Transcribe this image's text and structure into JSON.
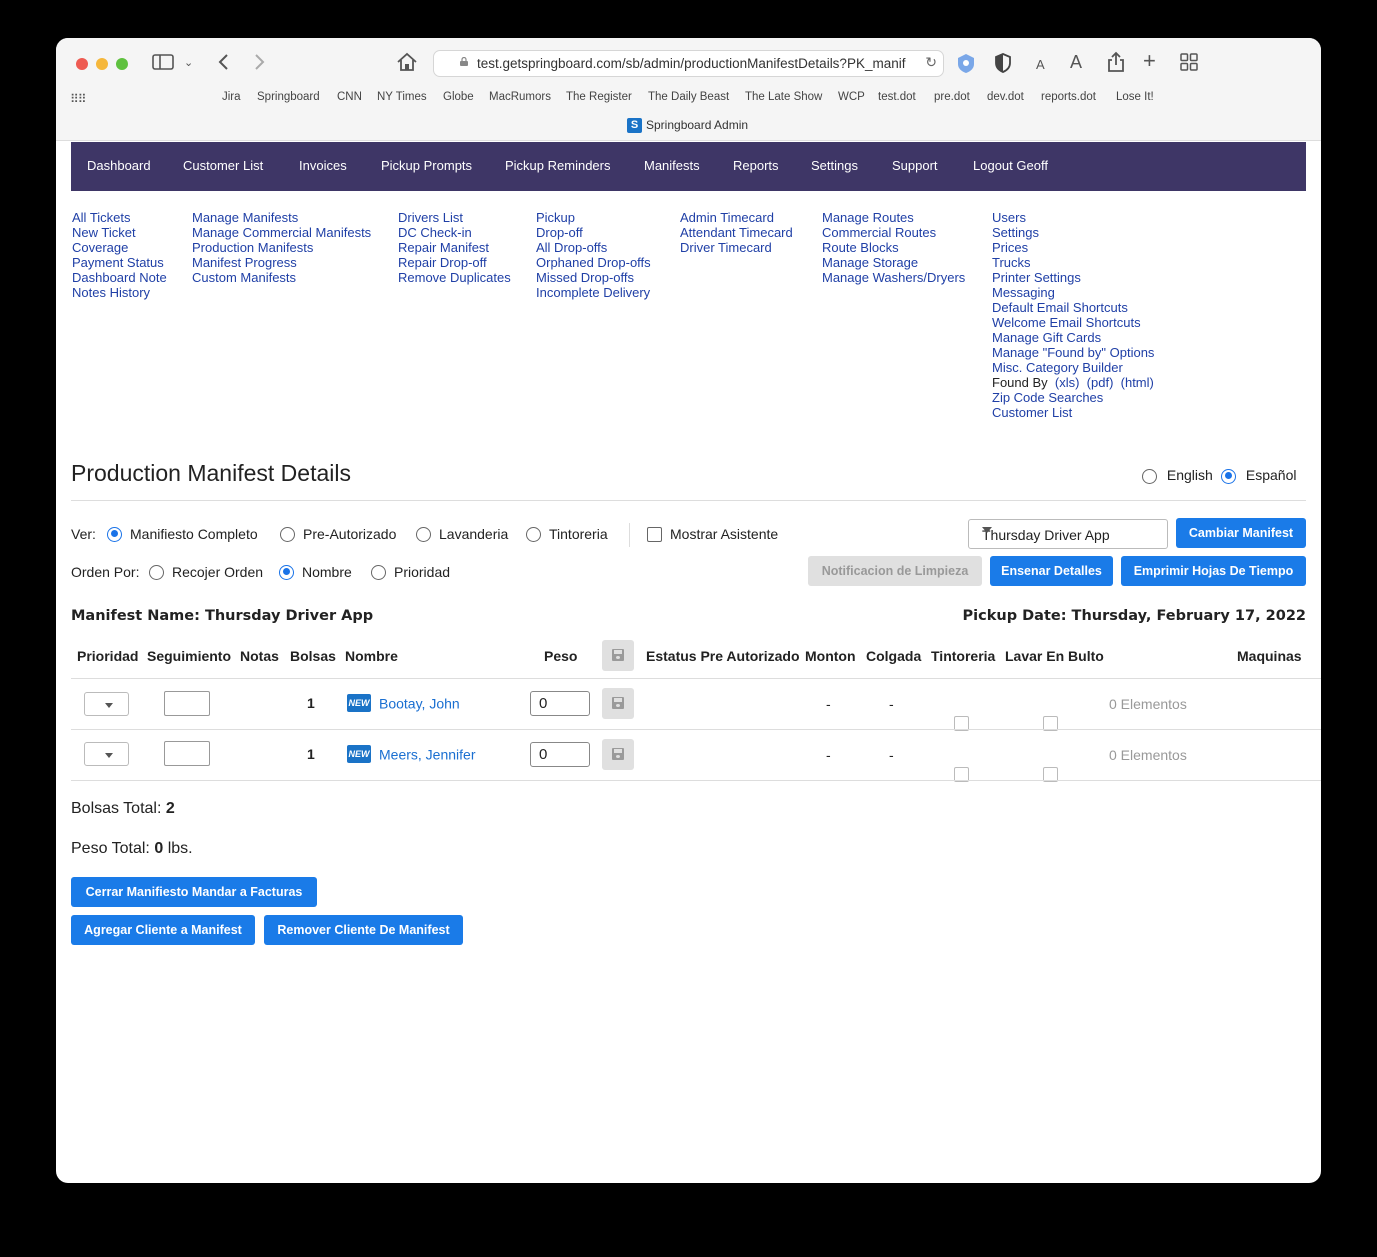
{
  "browser": {
    "url": "test.getspringboard.com/sb/admin/productionManifestDetails?PK_manif",
    "tab_title": "Springboard Admin",
    "favicon_letter": "S",
    "bookmarks": [
      "Jira",
      "Springboard",
      "CNN",
      "NY Times",
      "Globe",
      "MacRumors",
      "The Register",
      "The Daily Beast",
      "The Late Show",
      "WCP",
      "test.dot",
      "pre.dot",
      "dev.dot",
      "reports.dot",
      "Lose It!"
    ],
    "text_size_small": "A",
    "text_size_large": "A"
  },
  "nav": [
    "Dashboard",
    "Customer List",
    "Invoices",
    "Pickup Prompts",
    "Pickup Reminders",
    "Manifests",
    "Reports",
    "Settings",
    "Support",
    "Logout Geoff"
  ],
  "submenu": {
    "col1": [
      "All Tickets",
      "New Ticket",
      "Coverage",
      "Payment Status",
      "Dashboard Note",
      "Notes History"
    ],
    "col2": [
      "Manage Manifests",
      "Manage Commercial Manifests",
      "Production Manifests",
      "Manifest Progress",
      "Custom Manifests"
    ],
    "col3": [
      "Drivers List",
      "DC Check-in",
      "Repair Manifest",
      "Repair Drop-off",
      "Remove Duplicates"
    ],
    "col4": [
      "Pickup",
      "Drop-off",
      "All Drop-offs",
      "Orphaned Drop-offs",
      "Missed Drop-offs",
      "Incomplete Delivery"
    ],
    "col5": [
      "Admin Timecard",
      "Attendant Timecard",
      "Driver Timecard"
    ],
    "col6": [
      "Manage Routes",
      "Commercial Routes",
      "Route Blocks",
      "Manage Storage",
      "Manage Washers/Dryers"
    ],
    "col7": [
      "Users",
      "Settings",
      "Prices",
      "Trucks",
      "Printer Settings",
      "Messaging",
      "Default Email Shortcuts",
      "Welcome Email Shortcuts",
      "Manage Gift Cards",
      "Manage \"Found by\" Options",
      "Misc. Category Builder"
    ],
    "found_by_label": "Found By",
    "found_by_links": [
      "(xls)",
      "(pdf)",
      "(html)"
    ],
    "col7_tail": [
      "Zip Code Searches",
      "Customer List"
    ]
  },
  "page": {
    "title": "Production Manifest Details",
    "lang_english": "English",
    "lang_spanish": "Español",
    "ver_label": "Ver:",
    "ver_options": [
      "Manifiesto Completo",
      "Pre-Autorizado",
      "Lavanderia",
      "Tintoreria"
    ],
    "mostrar_asistente": "Mostrar Asistente",
    "manifest_select": "Thursday Driver App",
    "cambiar_manifest": "Cambiar Manifest",
    "orden_label": "Orden Por:",
    "orden_options": [
      "Recojer Orden",
      "Nombre",
      "Prioridad"
    ],
    "notificacion_btn": "Notificacion de Limpieza",
    "ensenar_btn": "Ensenar Detalles",
    "emprimir_btn": "Emprimir Hojas De Tiempo",
    "manifest_name": "Manifest Name: Thursday Driver App",
    "pickup_date": "Pickup Date: Thursday, February 17, 2022"
  },
  "table": {
    "headers": [
      "Prioridad",
      "Seguimiento",
      "Notas",
      "Bolsas",
      "Nombre",
      "Peso",
      "Estatus Pre Autorizado",
      "Monton",
      "Colgada",
      "Tintoreria",
      "Lavar En Bulto",
      "Maquinas"
    ],
    "new_badge": "NEW",
    "rows": [
      {
        "bolsas": "1",
        "nombre": "Bootay, John",
        "peso": "0",
        "monton": "-",
        "colgada": "-",
        "maquinas": "0 Elementos"
      },
      {
        "bolsas": "1",
        "nombre": "Meers, Jennifer",
        "peso": "0",
        "monton": "-",
        "colgada": "-",
        "maquinas": "0 Elementos"
      }
    ]
  },
  "totals": {
    "bolsas_label": "Bolsas Total:",
    "bolsas_value": "2",
    "peso_label": "Peso Total:",
    "peso_value": "0",
    "peso_unit": "lbs."
  },
  "actions": {
    "cerrar": "Cerrar Manifiesto Mandar a Facturas",
    "agregar": "Agregar Cliente a Manifest",
    "remover": "Remover Cliente De Manifest"
  }
}
